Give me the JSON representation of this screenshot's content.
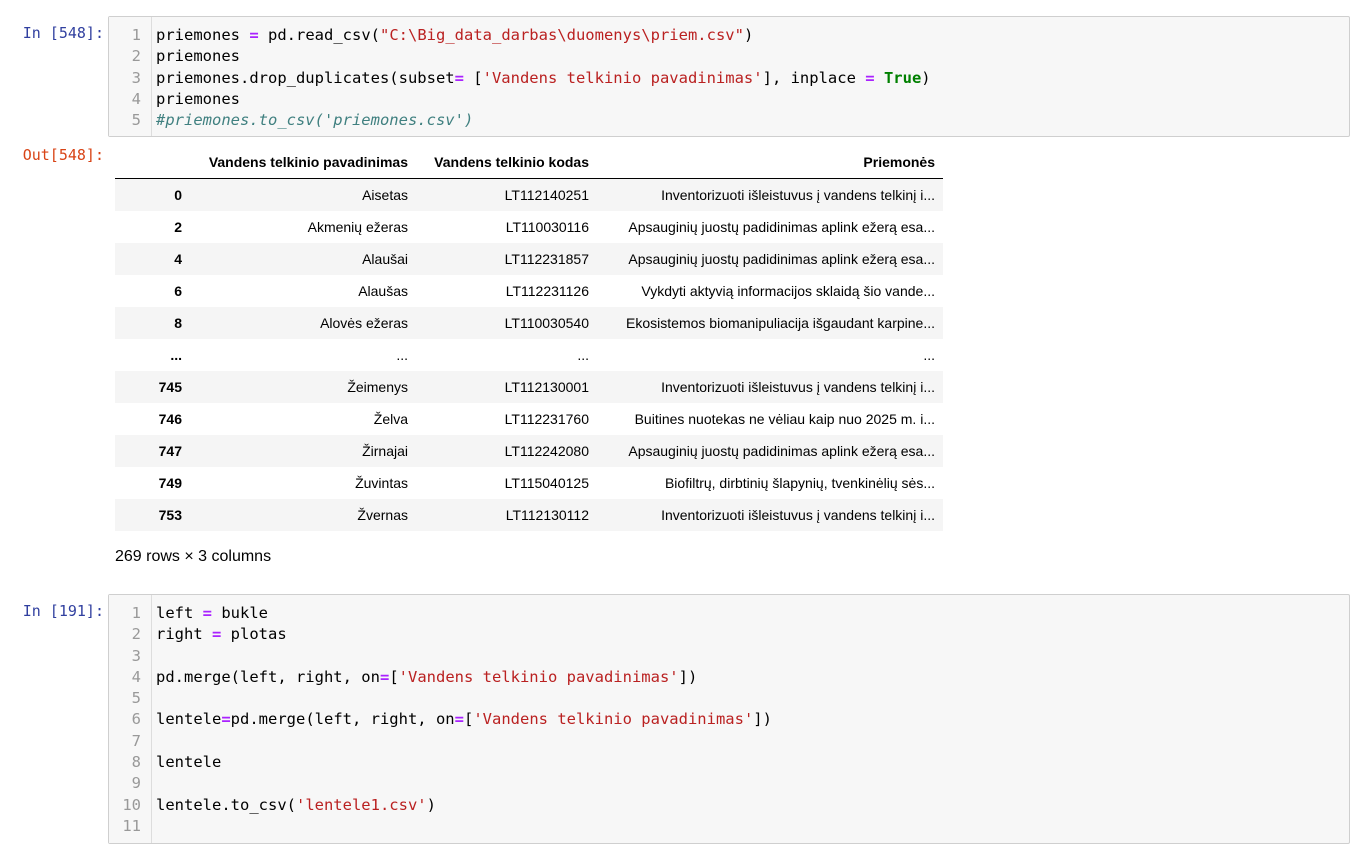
{
  "cell1": {
    "prompt": "In [548]:",
    "lines": [
      {
        "n": "1",
        "tokens": [
          [
            "plain",
            "priemones "
          ],
          [
            "op",
            "="
          ],
          [
            "plain",
            " pd.read_csv("
          ],
          [
            "str",
            "\"C:\\Big_data_darbas\\duomenys\\priem.csv\""
          ],
          [
            "plain",
            ")"
          ]
        ]
      },
      {
        "n": "2",
        "tokens": [
          [
            "plain",
            "priemones"
          ]
        ]
      },
      {
        "n": "3",
        "tokens": [
          [
            "plain",
            "priemones.drop_duplicates(subset"
          ],
          [
            "op",
            "="
          ],
          [
            "plain",
            " ["
          ],
          [
            "str",
            "'Vandens telkinio pavadinimas'"
          ],
          [
            "plain",
            "], inplace "
          ],
          [
            "op",
            "="
          ],
          [
            "plain",
            " "
          ],
          [
            "kw",
            "True"
          ],
          [
            "plain",
            ")"
          ]
        ]
      },
      {
        "n": "4",
        "tokens": [
          [
            "plain",
            "priemones"
          ]
        ]
      },
      {
        "n": "5",
        "tokens": [
          [
            "com",
            "#priemones.to_csv('priemones.csv')"
          ]
        ]
      }
    ]
  },
  "output1": {
    "prompt": "Out[548]:",
    "columns": [
      "",
      "Vandens telkinio pavadinimas",
      "Vandens telkinio kodas",
      "Priemonės"
    ],
    "rows": [
      [
        "0",
        "Aisetas",
        "LT112140251",
        "Inventorizuoti išleistuvus į vandens telkinį i..."
      ],
      [
        "2",
        "Akmenių ežeras",
        "LT110030116",
        "Apsauginių juostų padidinimas aplink ežerą esa..."
      ],
      [
        "4",
        "Alaušai",
        "LT112231857",
        "Apsauginių juostų padidinimas aplink ežerą esa..."
      ],
      [
        "6",
        "Alaušas",
        "LT112231126",
        "Vykdyti aktyvią informacijos sklaidą šio vande..."
      ],
      [
        "8",
        "Alovės ežeras",
        "LT110030540",
        "Ekosistemos biomanipuliacija išgaudant karpine..."
      ],
      [
        "...",
        "...",
        "...",
        "..."
      ],
      [
        "745",
        "Žeimenys",
        "LT112130001",
        "Inventorizuoti išleistuvus į vandens telkinį i..."
      ],
      [
        "746",
        "Želva",
        "LT112231760",
        "Buitines nuotekas ne vėliau kaip nuo 2025 m. i..."
      ],
      [
        "747",
        "Žirnajai",
        "LT112242080",
        "Apsauginių juostų padidinimas aplink ežerą esa..."
      ],
      [
        "749",
        "Žuvintas",
        "LT115040125",
        "Biofiltrų, dirbtinių šlapynių, tvenkinėlių sės..."
      ],
      [
        "753",
        "Žvernas",
        "LT112130112",
        "Inventorizuoti išleistuvus į vandens telkinį i..."
      ]
    ],
    "shape": "269 rows × 3 columns"
  },
  "cell2": {
    "prompt": "In [191]:",
    "lines": [
      {
        "n": "1",
        "tokens": [
          [
            "plain",
            "left "
          ],
          [
            "op",
            "="
          ],
          [
            "plain",
            " bukle"
          ]
        ]
      },
      {
        "n": "2",
        "tokens": [
          [
            "plain",
            "right "
          ],
          [
            "op",
            "="
          ],
          [
            "plain",
            " plotas"
          ]
        ]
      },
      {
        "n": "3",
        "tokens": []
      },
      {
        "n": "4",
        "tokens": [
          [
            "plain",
            "pd.merge(left, right, on"
          ],
          [
            "op",
            "="
          ],
          [
            "plain",
            "["
          ],
          [
            "str",
            "'Vandens telkinio pavadinimas'"
          ],
          [
            "plain",
            "])"
          ]
        ]
      },
      {
        "n": "5",
        "tokens": []
      },
      {
        "n": "6",
        "tokens": [
          [
            "plain",
            "lentele"
          ],
          [
            "op",
            "="
          ],
          [
            "plain",
            "pd.merge(left, right, on"
          ],
          [
            "op",
            "="
          ],
          [
            "plain",
            "["
          ],
          [
            "str",
            "'Vandens telkinio pavadinimas'"
          ],
          [
            "plain",
            "])"
          ]
        ]
      },
      {
        "n": "7",
        "tokens": []
      },
      {
        "n": "8",
        "tokens": [
          [
            "plain",
            "lentele"
          ]
        ]
      },
      {
        "n": "9",
        "tokens": []
      },
      {
        "n": "10",
        "tokens": [
          [
            "plain",
            "lentele.to_csv("
          ],
          [
            "str",
            "'lentele1.csv'"
          ],
          [
            "plain",
            ")"
          ]
        ]
      },
      {
        "n": "11",
        "tokens": []
      }
    ]
  }
}
